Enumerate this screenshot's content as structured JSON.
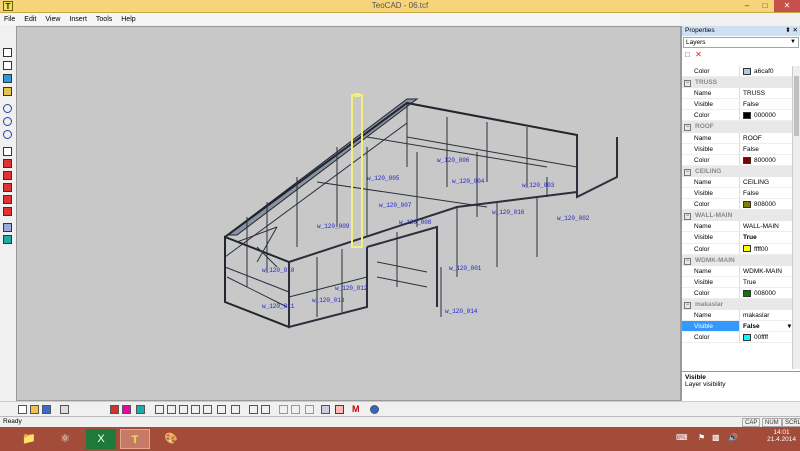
{
  "window": {
    "title": "TeoCAD - 06.tcf",
    "app_icon": "T",
    "minimize": "‒",
    "maximize": "□",
    "close": "✕"
  },
  "menu": [
    "File",
    "Edit",
    "View",
    "Insert",
    "Tools",
    "Help"
  ],
  "viewport": {
    "labels": [
      "w_120_002",
      "w_120_003",
      "w_120_004",
      "w_120_005",
      "w_120_006",
      "w_120_007",
      "w_120_008",
      "w_120_009",
      "w_120_010",
      "w_120_011",
      "w_120_012",
      "w_120_013",
      "w_120_014",
      "w_120_001",
      "w_120_016"
    ]
  },
  "properties": {
    "title": "Properties",
    "pin": "⬍",
    "close": "✕",
    "selector": "Layers",
    "new_icon": "□",
    "delete_icon": "✕",
    "top_row": {
      "key": "Color",
      "value": "a6caf0",
      "color": "#a6caf0"
    },
    "sections": [
      {
        "name": "TRUSS",
        "rows": [
          {
            "k": "Name",
            "v": "TRUSS"
          },
          {
            "k": "Visible",
            "v": "False"
          },
          {
            "k": "Color",
            "v": "000000",
            "c": "#000000"
          }
        ]
      },
      {
        "name": "ROOF",
        "rows": [
          {
            "k": "Name",
            "v": "ROOF"
          },
          {
            "k": "Visible",
            "v": "False"
          },
          {
            "k": "Color",
            "v": "800000",
            "c": "#800000"
          }
        ]
      },
      {
        "name": "CEILING",
        "rows": [
          {
            "k": "Name",
            "v": "CEILING"
          },
          {
            "k": "Visible",
            "v": "False"
          },
          {
            "k": "Color",
            "v": "808000",
            "c": "#808000"
          }
        ]
      },
      {
        "name": "WALL-MAIN",
        "rows": [
          {
            "k": "Name",
            "v": "WALL-MAIN"
          },
          {
            "k": "Visible",
            "v": "True",
            "bold": true
          },
          {
            "k": "Color",
            "v": "ffff00",
            "c": "#ffff00"
          }
        ]
      },
      {
        "name": "WDMK-MAIN",
        "rows": [
          {
            "k": "Name",
            "v": "WDMK-MAIN"
          },
          {
            "k": "Visible",
            "v": "True"
          },
          {
            "k": "Color",
            "v": "008000",
            "c": "#008000"
          }
        ]
      },
      {
        "name": "makaslar",
        "rows": [
          {
            "k": "Name",
            "v": "makaslar"
          },
          {
            "k": "Visible",
            "v": "False",
            "sel": true
          },
          {
            "k": "Color",
            "v": "00ffff",
            "c": "#00ffff"
          }
        ]
      }
    ],
    "desc_title": "Visible",
    "desc_text": "Layer visibility"
  },
  "status": {
    "text": "Ready",
    "cap": "CAP",
    "num": "NUM",
    "scrl": "SCRL"
  },
  "taskbar": {
    "apps": [
      "explorer-icon",
      "ie-icon",
      "excel-icon",
      "teocad-icon",
      "paint-icon"
    ],
    "time": "14:01",
    "date": "21.4.2014"
  }
}
